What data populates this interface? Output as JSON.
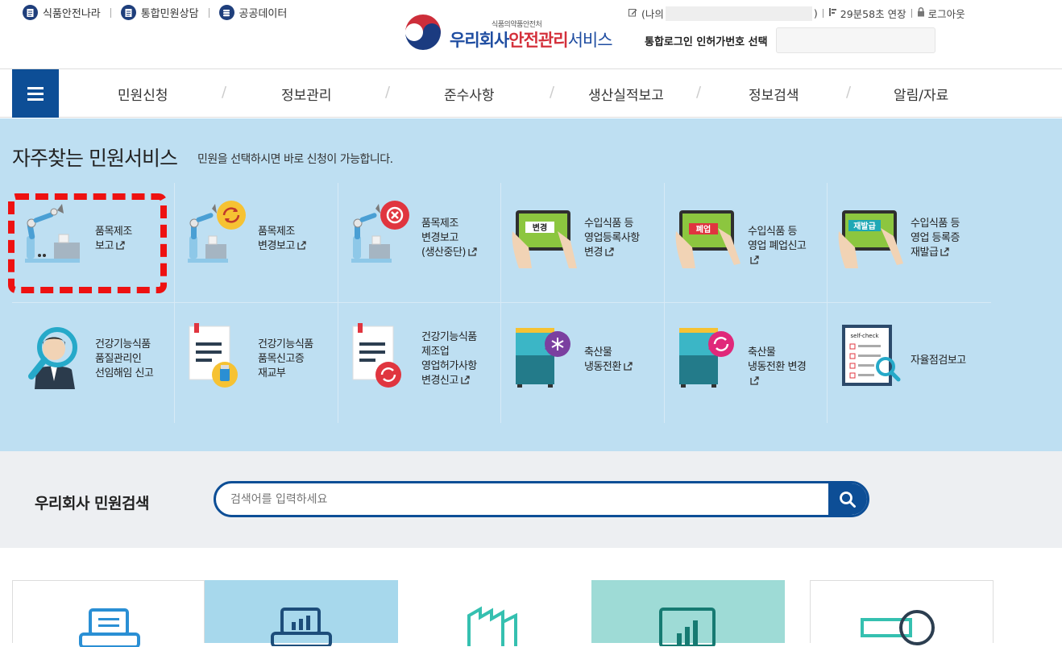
{
  "top_links": [
    {
      "label": "식품안전나라",
      "icon": "document-icon"
    },
    {
      "label": "통합민원상담",
      "icon": "document-icon"
    },
    {
      "label": "공공데이터",
      "icon": "database-icon"
    }
  ],
  "logo": {
    "sub": "식품의약품안전처",
    "main_prefix": "우리회사",
    "main_accent": "안전관리",
    "main_suffix": "서비스"
  },
  "session": {
    "user_prefix": "(나의",
    "user_suffix": ")",
    "timer": "29분58초 연장",
    "logout": "로그아웃"
  },
  "login_select_label": "통합로그인 인허가번호 선택",
  "nav": [
    "민원신청",
    "정보관리",
    "준수사항",
    "생산실적보고",
    "정보검색",
    "알림/자료"
  ],
  "quick": {
    "title": "자주찾는 민원서비스",
    "subtitle": "민원을 선택하시면 바로 신청이 가능합니다.",
    "items": [
      {
        "label": "품목제조\n보고",
        "icon": "robot-arm-icon"
      },
      {
        "label": "품목제조\n변경보고",
        "icon": "robot-arm-refresh-icon"
      },
      {
        "label": "품목제조\n변경보고\n(생산중단)",
        "icon": "robot-arm-stop-icon"
      },
      {
        "label": "수입식품 등\n영업등록사항\n변경",
        "icon": "tablet-change-icon",
        "badge": "변경"
      },
      {
        "label": "수입식품 등\n영업 폐업신고",
        "icon": "tablet-close-icon",
        "badge": "폐업"
      },
      {
        "label": "수입식품 등\n영업 등록증\n재발급",
        "icon": "tablet-reissue-icon",
        "badge": "재발급"
      },
      {
        "label": "건강기능식품\n품질관리인\n선임해임 신고",
        "icon": "person-magnifier-icon"
      },
      {
        "label": "건강기능식품\n품목신고증\n재교부",
        "icon": "document-bottle-icon"
      },
      {
        "label": "건강기능식품\n제조업\n영업허가사항\n변경신고",
        "icon": "document-refresh-icon"
      },
      {
        "label": "축산물\n냉동전환",
        "icon": "freezer-snowflake-icon"
      },
      {
        "label": "축산물\n냉동전환 변경",
        "icon": "freezer-refresh-icon"
      },
      {
        "label": "자율점검보고",
        "icon": "self-check-icon",
        "badge": "self-check"
      }
    ]
  },
  "search": {
    "label": "우리회사 민원검색",
    "placeholder": "검색어를 입력하세요"
  },
  "colors": {
    "brand_blue": "#0d4e96",
    "quick_bg": "#bedff2",
    "highlight_red": "#ee1111"
  }
}
